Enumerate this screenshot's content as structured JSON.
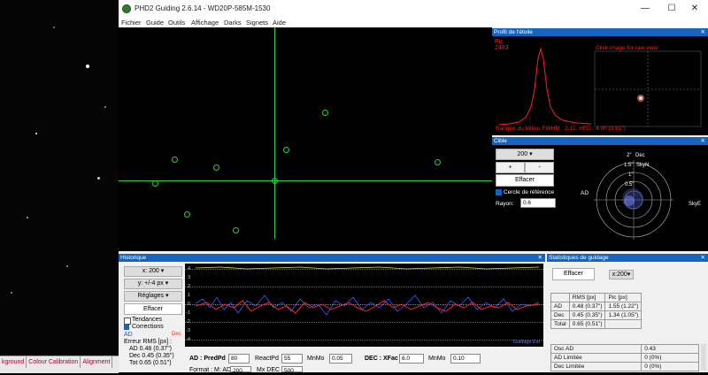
{
  "window": {
    "title": "PHD2 Guiding 2.6.14 - WD20P-585M-1530",
    "min": "—",
    "max": "☐",
    "close": "✕"
  },
  "menu": [
    "Fichier",
    "Guide",
    "Outils",
    "Affichage",
    "Darks",
    "Signets",
    "Aide"
  ],
  "bg_tabs": [
    "kground",
    "Colour Calibration",
    "Alignment"
  ],
  "profile": {
    "title": "Profil de l'étoile",
    "peak_label": "Pic",
    "peak_value": "2483",
    "hint": "Click image for raw view",
    "footer": "Rangée du Milieu FWHM : 2.12, HFD : 4.00 (3.61\")"
  },
  "target": {
    "title": "Cible",
    "scale": "200",
    "plus": "+",
    "minus": "-",
    "clear": "Effacer",
    "ref_circle": "Cercle de référence",
    "radius_label": "Rayon:",
    "radius_value": "0.6",
    "dec_label": "Dec",
    "ad_label": "AD",
    "ring_labels": [
      "2\"",
      "1.5\"",
      "1\"",
      "0.5\""
    ],
    "skyn": "SkyN",
    "skye": "SkyE"
  },
  "history": {
    "title": "Historique",
    "x_select": "x: 200",
    "y_select": "y: +/-4 px",
    "settings": "Réglages",
    "clear": "Effacer",
    "trend": "Tendances",
    "corrections": "Corrections",
    "ad": "AD",
    "dec": "Dec",
    "rms_title": "Erreur RMS [px] :",
    "rms_ad": "AD 0.48 (0.37\")",
    "rms_dec": "Dec 0.45 (0.35\")",
    "rms_tot": "Tot 0.65 (0.51\")",
    "y_ticks": [
      "4",
      "3",
      "2",
      "1",
      "0",
      "-1",
      "-2",
      "-3",
      "-4"
    ],
    "guide_label": "Guidage Est",
    "params": {
      "ad_label": "AD : PredPd",
      "predpd": "80",
      "reactpd_label": "ReactPd",
      "reactpd": "55",
      "mnmo_label": "MnMo",
      "mnmo": "0.05",
      "dec_label": "DEC : XFac",
      "xfac": "6.0",
      "dec_mnmo_label": "MnMo",
      "dec_mnmo": "0.10",
      "row2_label": "Format : M: AD",
      "row2_v1": "200",
      "row2_label2": "Mx DEC",
      "row2_v2": "500"
    }
  },
  "stats": {
    "title": "Statistiques de guidage",
    "clear": "Effacer",
    "x_select": "x:200",
    "headers": [
      "",
      "RMS [px]",
      "Pic [px]"
    ],
    "rows": [
      [
        "AD",
        "0.48 (0.37\")",
        "1.55 (1.22\")"
      ],
      [
        "Dec",
        "0.45 (0.35\")",
        "1.34 (1.05\")"
      ],
      [
        "Total",
        "0.65 (0.51\")",
        ""
      ]
    ],
    "extra": [
      [
        "Osc AD",
        "0.43"
      ],
      [
        "AD Limitée",
        "0 (0%)"
      ],
      [
        "Dec Limitée",
        "0 (0%)"
      ]
    ]
  },
  "colors": {
    "accent": "#1464c0",
    "crosshair": "#2ecc40",
    "ad_line": "#3a5cff",
    "dec_line": "#ff2020"
  }
}
